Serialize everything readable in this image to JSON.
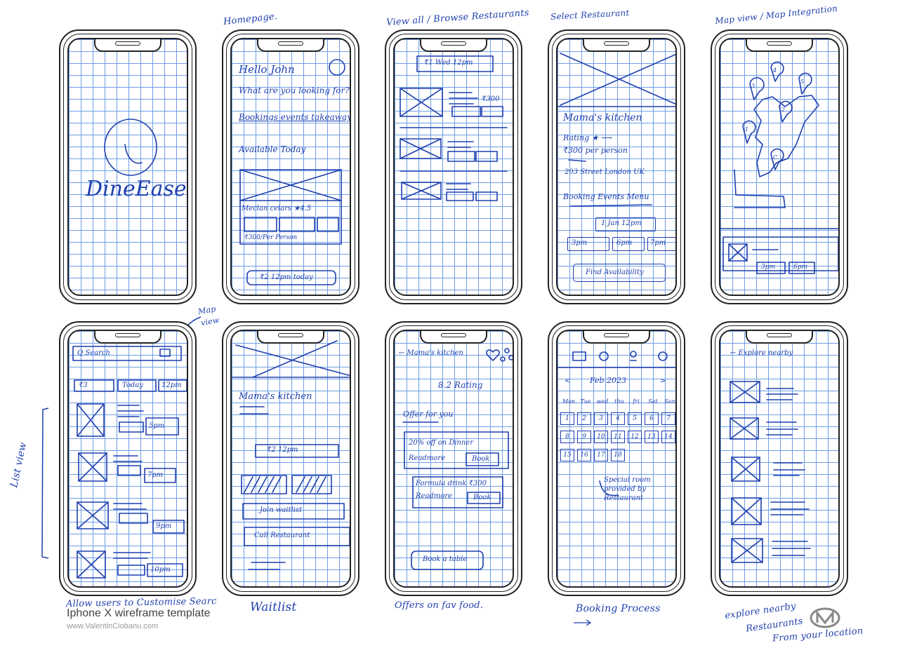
{
  "template": {
    "title": "Iphone X wireframe template",
    "url": "www.ValentinCiobanu.com"
  },
  "screen_titles": [
    "Homepage.",
    "View all / Browse Restaurants",
    "Select Restaurant",
    "Map view / Map Integration"
  ],
  "captions": {
    "customise": "Allow users to Customise Searc",
    "waitlist": "Waitlist",
    "offers": "Offers on fav food.",
    "booking": "Booking Process",
    "explore_line1": "explore nearby",
    "explore_line2": "Restaurants",
    "explore_line3": "From your location"
  },
  "side_notes": {
    "map_view": [
      "Map",
      "view"
    ],
    "list_view": "List view"
  },
  "splash": {
    "brand": "DineEase"
  },
  "home": {
    "greeting": "Hello John",
    "question": "What are you looking for?",
    "tabs": "Bookings events takeaway",
    "section": "Available Today",
    "card_title": "Meclan celars ★4.5",
    "card_price": "₹300/Per Person",
    "cta": "₹2 12pm today"
  },
  "browse": {
    "filter": "₹1 Wed 12pm",
    "price": "₹300"
  },
  "restaurant": {
    "name": "Mama's kitchen",
    "rating": "Rating ★ ⟶",
    "price": "₹300 per person",
    "address": "203 Street London UK",
    "tabs": "Booking Events Menu",
    "date": "1 Jan 12pm",
    "times": [
      "3pm",
      "6pm",
      "7pm"
    ],
    "cta": "Find Availability"
  },
  "map": {
    "pins": [
      "3",
      "4",
      "5",
      "2",
      "1",
      "C"
    ],
    "times": [
      "3pm",
      "6pm"
    ]
  },
  "search": {
    "placeholder": "Q Search",
    "filters": [
      "₹3",
      "Today",
      "12pm"
    ],
    "times": [
      "5pm",
      "7pm",
      "9pm",
      "10pm"
    ]
  },
  "waitlist": {
    "name": "Mama's kitchen",
    "slot": "₹2 12pm",
    "join": "Join waitlist",
    "call": "Call Restaurant"
  },
  "offers": {
    "back": "← Mama's kitchen",
    "rating": "8.2 Rating",
    "heading": "Offer for you",
    "offer1": "20% off on Dinner",
    "offer1_more": "Readmore",
    "offer1_btn": "Book",
    "offer2": "Formula drink ₹300",
    "offer2_more": "Readmore",
    "offer2_btn": "Book",
    "cta": "Book a table"
  },
  "calendar": {
    "month": "Feb 2023",
    "prev": "<",
    "next": ">",
    "days": [
      "Mon",
      "Tue",
      "wed",
      "thu",
      "fri",
      "Sat",
      "Sun"
    ],
    "week1": [
      "1",
      "2",
      "3",
      "4",
      "5",
      "6",
      "7"
    ],
    "week2": [
      "8",
      "9",
      "10",
      "11",
      "12",
      "13",
      "14"
    ],
    "week3": [
      "15",
      "16",
      "17",
      "18"
    ],
    "note": "Special room provided by Restaurant"
  },
  "explore": {
    "back": "← Explore nearby"
  }
}
